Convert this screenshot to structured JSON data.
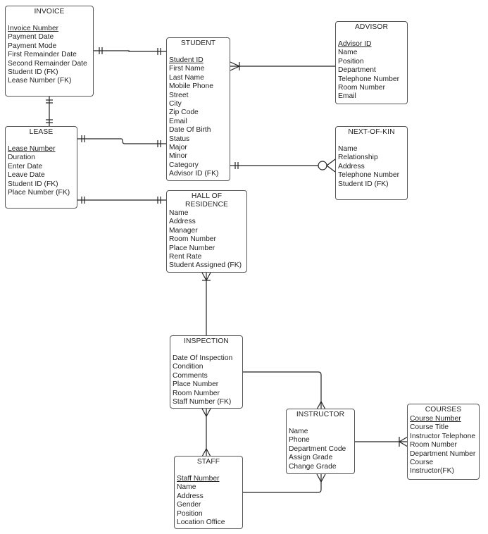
{
  "diagram_title": "",
  "entities": {
    "invoice": {
      "name": "INVOICE",
      "attributes": [
        {
          "label": "Invoice Number",
          "key": "pk"
        },
        {
          "label": "Payment Date"
        },
        {
          "label": "Payment Mode"
        },
        {
          "label": "First Remainder Date"
        },
        {
          "label": "Second Remainder Date"
        },
        {
          "label": "Student ID (FK)"
        },
        {
          "label": "Lease Number (FK)"
        }
      ]
    },
    "lease": {
      "name": "LEASE",
      "attributes": [
        {
          "label": "Lease Number",
          "key": "pk"
        },
        {
          "label": "Duration"
        },
        {
          "label": "Enter Date"
        },
        {
          "label": "Leave Date"
        },
        {
          "label": "Student ID (FK)"
        },
        {
          "label": "Place Number (FK)"
        }
      ]
    },
    "student": {
      "name": "STUDENT",
      "attributes": [
        {
          "label": "Student ID",
          "key": "pk"
        },
        {
          "label": "First Name"
        },
        {
          "label": "Last Name"
        },
        {
          "label": "Mobile Phone"
        },
        {
          "label": "Street"
        },
        {
          "label": "City"
        },
        {
          "label": "Zip Code"
        },
        {
          "label": "Email"
        },
        {
          "label": "Date Of Birth"
        },
        {
          "label": "Status"
        },
        {
          "label": "Major"
        },
        {
          "label": "Minor"
        },
        {
          "label": "Category"
        },
        {
          "label": "Advisor ID (FK)"
        }
      ]
    },
    "advisor": {
      "name": "ADVISOR",
      "attributes": [
        {
          "label": "Advisor ID",
          "key": "pk"
        },
        {
          "label": "Name"
        },
        {
          "label": "Position"
        },
        {
          "label": "Department"
        },
        {
          "label": "Telephone Number"
        },
        {
          "label": "Room Number"
        },
        {
          "label": "Email"
        }
      ]
    },
    "next_of_kin": {
      "name": "NEXT-OF-KIN",
      "attributes": [
        {
          "label": "Name"
        },
        {
          "label": "Relationship"
        },
        {
          "label": "Address"
        },
        {
          "label": "Telephone Number"
        },
        {
          "label": "Student ID (FK)"
        }
      ]
    },
    "hall_of_residence": {
      "name": "HALL OF RESIDENCE",
      "attributes": [
        {
          "label": "Name"
        },
        {
          "label": "Address"
        },
        {
          "label": "Manager"
        },
        {
          "label": "Room Number"
        },
        {
          "label": "Place Number"
        },
        {
          "label": "Rent Rate"
        },
        {
          "label": "Student Assigned (FK)"
        }
      ]
    },
    "inspection": {
      "name": "INSPECTION",
      "attributes": [
        {
          "label": "Date Of Inspection"
        },
        {
          "label": "Condition"
        },
        {
          "label": "Comments"
        },
        {
          "label": "Place Number"
        },
        {
          "label": "Room Number"
        },
        {
          "label": "Staff Number (FK)"
        }
      ]
    },
    "instructor": {
      "name": "INSTRUCTOR",
      "attributes": [
        {
          "label": "Name"
        },
        {
          "label": "Phone"
        },
        {
          "label": "Department Code"
        },
        {
          "label": "Assign Grade"
        },
        {
          "label": "Change Grade"
        }
      ]
    },
    "courses": {
      "name": "COURSES",
      "attributes": [
        {
          "label": "Course Number",
          "key": "pk"
        },
        {
          "label": "Course Title"
        },
        {
          "label": "Instructor Telephone"
        },
        {
          "label": "Room Number"
        },
        {
          "label": "Department Number"
        },
        {
          "label": "Course"
        },
        {
          "label": "Instructor(FK)"
        }
      ]
    },
    "staff": {
      "name": "STAFF",
      "attributes": [
        {
          "label": "Staff Number",
          "key": "pk"
        },
        {
          "label": "Name"
        },
        {
          "label": "Address"
        },
        {
          "label": "Gender"
        },
        {
          "label": "Position"
        },
        {
          "label": "Location Office"
        }
      ]
    }
  },
  "relationships": [
    {
      "from": "invoice",
      "to": "student",
      "from_card": "one-and-only-one",
      "to_card": "one-and-only-one"
    },
    {
      "from": "invoice",
      "to": "lease",
      "from_card": "one-and-only-one",
      "to_card": "one-and-only-one"
    },
    {
      "from": "lease",
      "to": "student",
      "from_card": "one-and-only-one",
      "to_card": "one-and-only-one"
    },
    {
      "from": "lease",
      "to": "hall_of_residence",
      "from_card": "one-and-only-one",
      "to_card": "one-and-only-one"
    },
    {
      "from": "student",
      "to": "advisor",
      "from_card": "one-or-many",
      "to_card": "none"
    },
    {
      "from": "student",
      "to": "next_of_kin",
      "from_card": "one-and-only-one",
      "to_card": "zero-or-many"
    },
    {
      "from": "hall_of_residence",
      "to": "inspection",
      "from_card": "one-or-many",
      "to_card": "none"
    },
    {
      "from": "inspection",
      "to": "staff",
      "from_card": "many",
      "to_card": "many"
    },
    {
      "from": "inspection",
      "to": "instructor",
      "from_card": "none",
      "to_card": "many"
    },
    {
      "from": "staff",
      "to": "instructor",
      "from_card": "none",
      "to_card": "many"
    },
    {
      "from": "instructor",
      "to": "courses",
      "from_card": "none",
      "to_card": "one-or-many"
    }
  ]
}
